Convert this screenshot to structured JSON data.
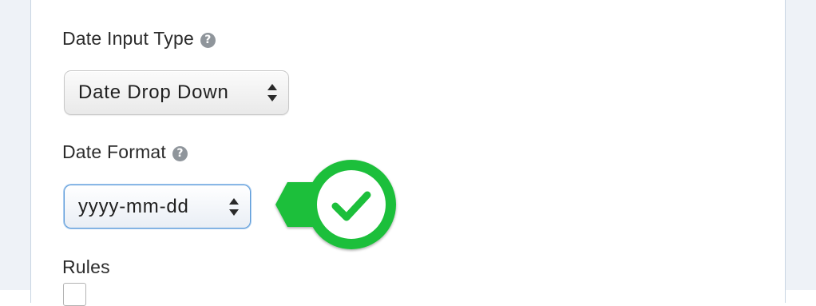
{
  "fields": {
    "date_input_type": {
      "label": "Date Input Type",
      "help": "?",
      "selected": "Date Drop Down"
    },
    "date_format": {
      "label": "Date Format",
      "help": "?",
      "selected": "yyyy-mm-dd"
    },
    "rules": {
      "label": "Rules"
    }
  },
  "colors": {
    "accent_green": "#1fbf3a",
    "focus_blue": "#5d9bd8",
    "help_gray": "#8f959b"
  },
  "icons": {
    "help": "question-circle-icon",
    "select_arrows": "sort-arrows-icon",
    "badge": "check-circle-icon"
  }
}
